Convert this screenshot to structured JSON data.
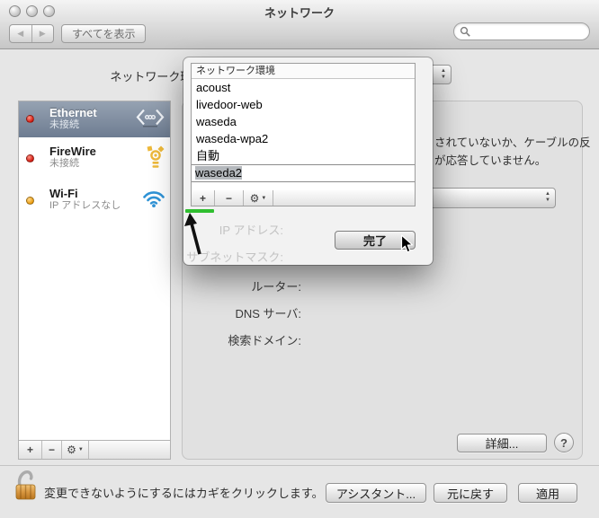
{
  "window": {
    "title": "ネットワーク"
  },
  "toolbar": {
    "back_glyph": "◀",
    "forward_glyph": "▶",
    "show_all_label": "すべてを表示",
    "search_value": ""
  },
  "content": {
    "location_popup_label": "ネットワーク環境:",
    "sidebar": {
      "services": [
        {
          "name": "Ethernet",
          "status": "未接続",
          "dot_color": "#d31a10",
          "selected": true
        },
        {
          "name": "FireWire",
          "status": "未接続",
          "dot_color": "#d31a10",
          "selected": false
        },
        {
          "name": "Wi-Fi",
          "status": "IP アドレスなし",
          "dot_color": "#eb9c0e",
          "selected": false
        }
      ],
      "add_label": "+",
      "remove_label": "−",
      "action_glyph": "⚙",
      "action_arrow": "▼"
    },
    "details": {
      "status_text_line1": "されていないか、ケーブルの反",
      "status_text_line2": "が応答していません。",
      "ip_label": "IP アドレス:",
      "subnet_label": "サブネットマスク:",
      "router_label": "ルーター:",
      "dns_label": "DNS サーバ:",
      "search_domain_label": "検索ドメイン:",
      "advanced_label": "詳細...",
      "help_label": "?"
    },
    "steppers": {
      "up": "▲",
      "down": "▼"
    }
  },
  "sheet": {
    "column_header": "ネットワーク環境",
    "locations": [
      "acoust",
      "livedoor-web",
      "waseda",
      "waseda-wpa2",
      "自動"
    ],
    "edit_value": "waseda2",
    "add_label": "+",
    "remove_label": "−",
    "action_glyph": "⚙",
    "action_arrow": "▼",
    "done_label": "完了"
  },
  "footer": {
    "lock_text": "変更できないようにするにはカギをクリックします。",
    "assistant_label": "アシスタント...",
    "revert_label": "元に戻す",
    "apply_label": "適用"
  },
  "annotations": {
    "underline_color": "#2fbe2f",
    "arrow": "black-arrow-pointing-to-add-button",
    "cursor": "pointer-on-done-button"
  }
}
